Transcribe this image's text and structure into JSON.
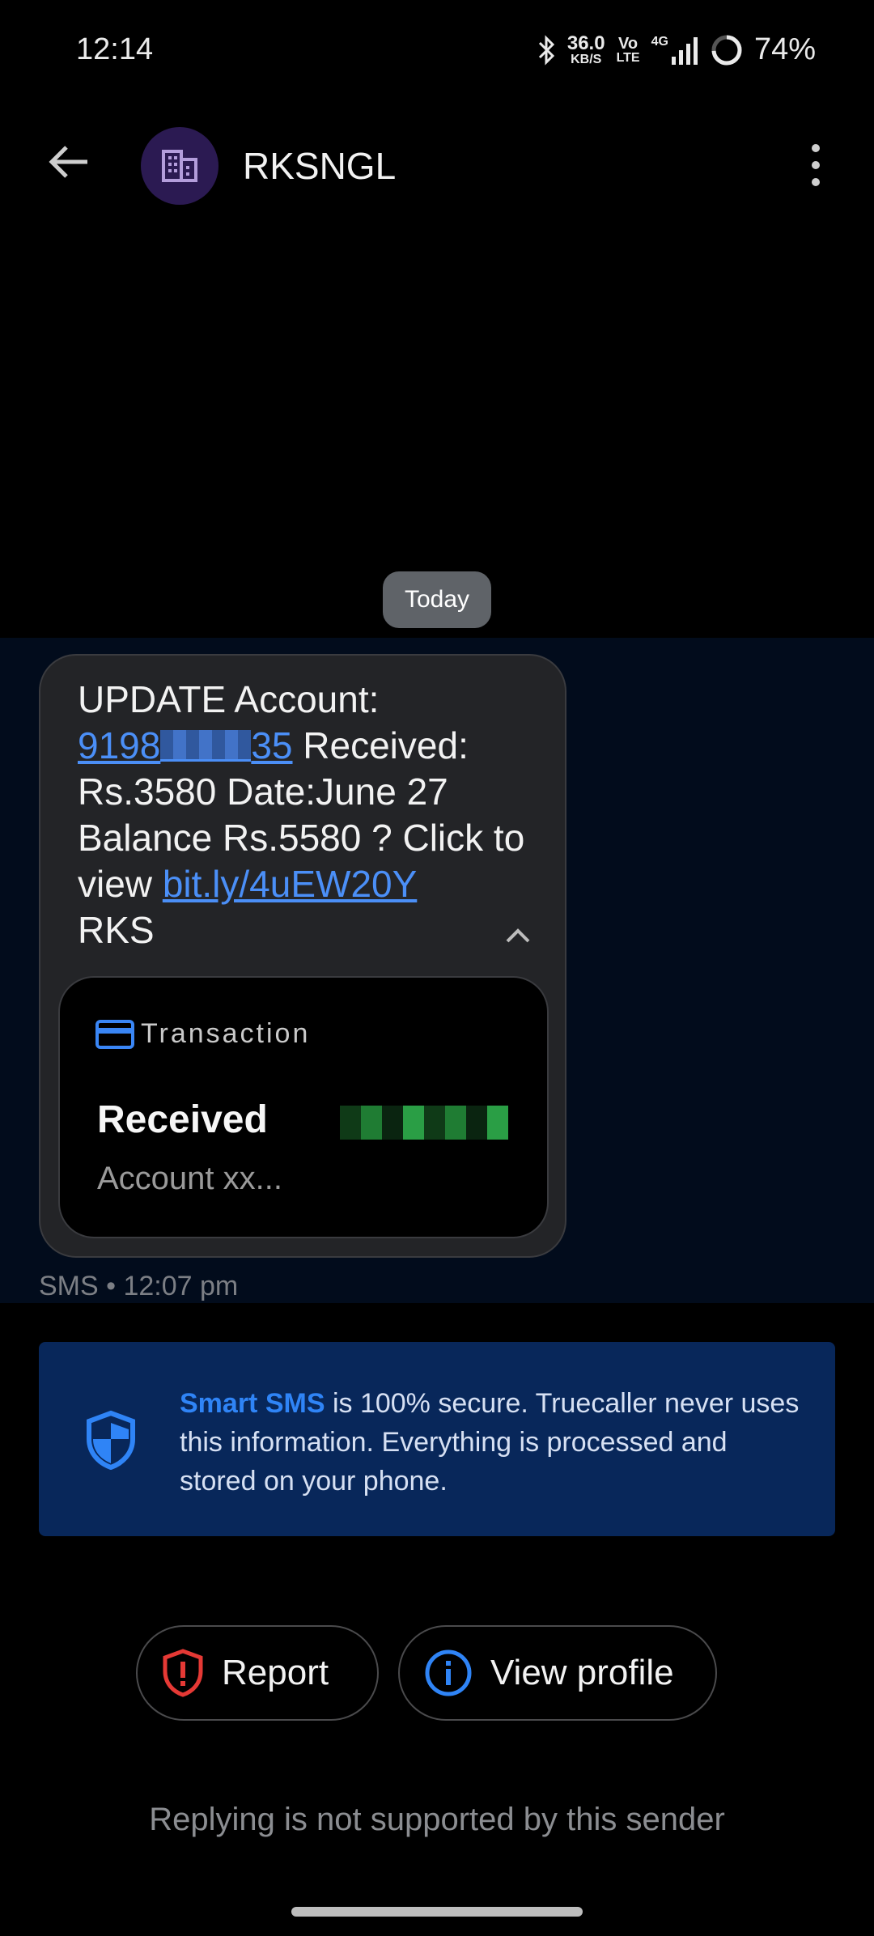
{
  "status_bar": {
    "time": "12:14",
    "net_speed_value": "36.0",
    "net_speed_unit": "KB/S",
    "volte_top": "Vo",
    "volte_bottom": "LTE",
    "network": "4G",
    "battery": "74%"
  },
  "app_bar": {
    "sender": "RKSNGL",
    "avatar_icon": "building-icon",
    "avatar_color": "#2b1a52"
  },
  "date_chip": "Today",
  "message": {
    "line1": "UPDATE Account:",
    "phone_prefix": "9198",
    "phone_suffix": "35",
    "after_phone": " Received:",
    "body": "Rs.3580 Date:June 27 Balance Rs.5580 ? Click to view ",
    "link": "bit.ly/4uEW20Y",
    "signature": "RKS",
    "meta": "SMS • 12:07 pm"
  },
  "transaction_card": {
    "title": "Transaction",
    "status": "Received",
    "account": "Account xx..."
  },
  "smart_sms": {
    "highlight": "Smart SMS",
    "text": " is 100% secure. Truecaller never uses this information. Everything is processed and stored on your phone."
  },
  "actions": {
    "report": "Report",
    "view_profile": "View profile"
  },
  "footer": {
    "no_reply": "Replying is not supported by this sender"
  },
  "colors": {
    "accent_blue": "#2f84f6",
    "report_red": "#e53935",
    "banner_bg": "#08275a",
    "bubble_bg": "#232427"
  }
}
